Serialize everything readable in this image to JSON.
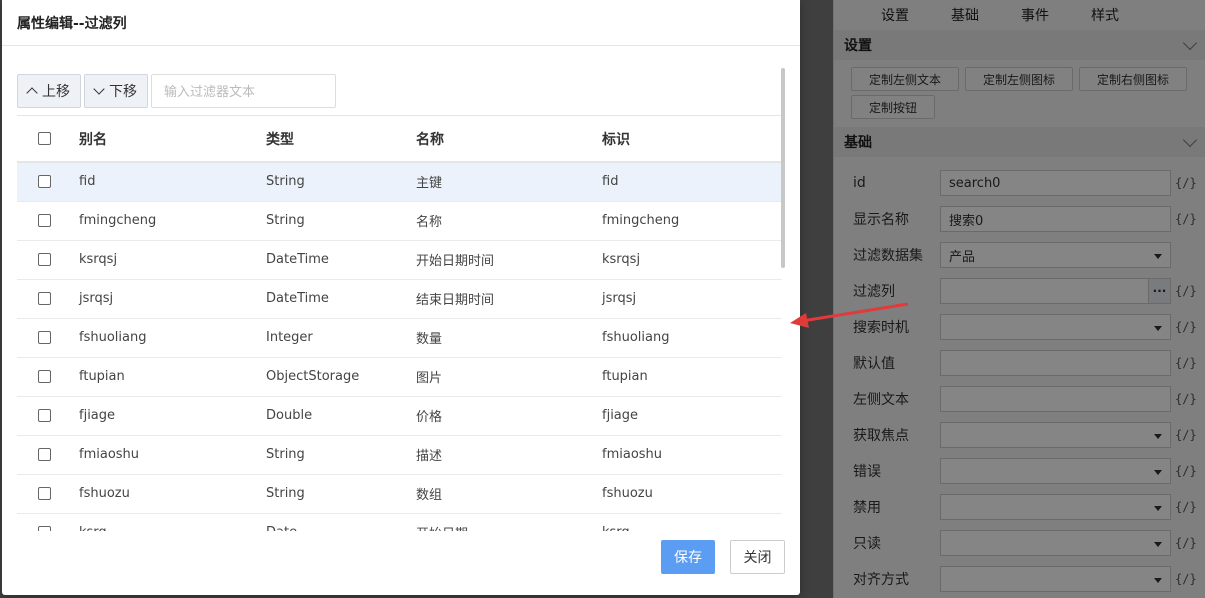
{
  "panel": {
    "tabs": [
      "设置",
      "基础",
      "事件",
      "样式"
    ],
    "section_settings": "设置",
    "custom_buttons": [
      "定制左侧文本",
      "定制左侧图标",
      "定制右侧图标",
      "定制按钮"
    ],
    "section_basic": "基础",
    "code_icon": "{/}",
    "props": [
      {
        "label": "id",
        "value": "search0"
      },
      {
        "label": "显示名称",
        "value": "搜索0"
      },
      {
        "label": "过滤数据集",
        "value": "产品"
      },
      {
        "label": "过滤列",
        "value": "",
        "button": "···"
      },
      {
        "label": "搜索时机",
        "value": ""
      },
      {
        "label": "默认值",
        "value": ""
      },
      {
        "label": "左侧文本",
        "value": ""
      },
      {
        "label": "获取焦点",
        "value": ""
      },
      {
        "label": "错误",
        "value": ""
      },
      {
        "label": "禁用",
        "value": ""
      },
      {
        "label": "只读",
        "value": ""
      },
      {
        "label": "对齐方式",
        "value": ""
      }
    ]
  },
  "modal": {
    "title": "属性编辑--过滤列",
    "move_up": "上移",
    "move_down": "下移",
    "filter_placeholder": "输入过滤器文本",
    "columns": [
      "别名",
      "类型",
      "名称",
      "标识"
    ],
    "rows": [
      [
        "fid",
        "String",
        "主键",
        "fid"
      ],
      [
        "fmingcheng",
        "String",
        "名称",
        "fmingcheng"
      ],
      [
        "ksrqsj",
        "DateTime",
        "开始日期时间",
        "ksrqsj"
      ],
      [
        "jsrqsj",
        "DateTime",
        "结束日期时间",
        "jsrqsj"
      ],
      [
        "fshuoliang",
        "Integer",
        "数量",
        "fshuoliang"
      ],
      [
        "ftupian",
        "ObjectStorage",
        "图片",
        "ftupian"
      ],
      [
        "fjiage",
        "Double",
        "价格",
        "fjiage"
      ],
      [
        "fmiaoshu",
        "String",
        "描述",
        "fmiaoshu"
      ],
      [
        "fshuozu",
        "String",
        "数组",
        "fshuozu"
      ],
      [
        "ksrq",
        "Date",
        "开始日期",
        "ksrq"
      ]
    ],
    "save": "保存",
    "close": "关闭"
  }
}
